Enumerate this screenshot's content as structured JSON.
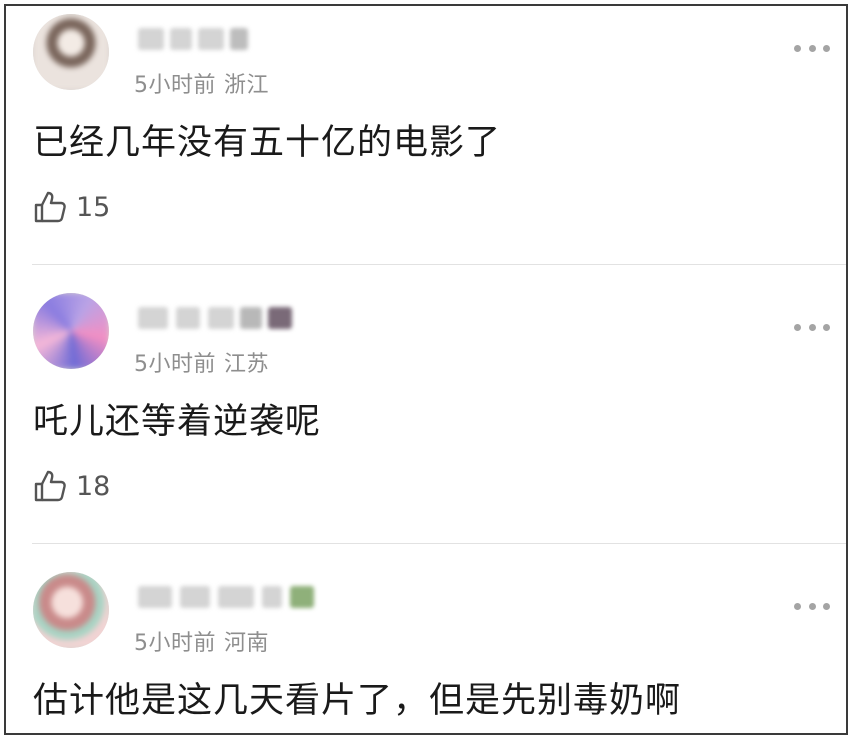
{
  "comments": [
    {
      "time": "5小时前",
      "location": "浙江",
      "text": "已经几年没有五十亿的电影了",
      "likes": "15",
      "avatar_colors": [
        "#e9e2dc",
        "#6b5a52",
        "#c9b8ad"
      ]
    },
    {
      "time": "5小时前",
      "location": "江苏",
      "text": "吒儿还等着逆袭呢",
      "likes": "18",
      "avatar_colors": [
        "#b9a3e6",
        "#f28fc3",
        "#6f6bd6"
      ]
    },
    {
      "time": "5小时前",
      "location": "河南",
      "text": "估计他是这几天看片了，但是先别毒奶啊",
      "likes": "",
      "avatar_colors": [
        "#f4d8d8",
        "#c98a8a",
        "#a8d4c4"
      ]
    }
  ],
  "icons": {
    "like": "thumbs-up-icon",
    "more": "more-dots-icon"
  },
  "colors": {
    "text_primary": "#1a1a1a",
    "text_meta": "#8e8e8e",
    "divider": "#e2e2e2",
    "frame_border": "#3a3a3a"
  }
}
